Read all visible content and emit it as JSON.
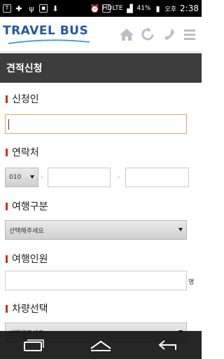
{
  "status_bar": {
    "time": "2:38",
    "ampm": "오후",
    "battery": "41%",
    "network": "LTE",
    "icons": [
      "notification-t-icon",
      "plus-icon",
      "usb-icon",
      "sd-card-icon",
      "download-icon",
      "alarm-icon",
      "hd-icon",
      "lte-icon",
      "signal-icon"
    ]
  },
  "header": {
    "logo_text": "TRAVEL BUS",
    "icons": [
      "home-icon",
      "refresh-icon",
      "phone-icon",
      "menu-icon"
    ]
  },
  "page": {
    "title": "견적신청"
  },
  "form": {
    "applicant": {
      "label": "신청인",
      "value": ""
    },
    "contact": {
      "label": "연락처",
      "prefix": "010",
      "separator": "-",
      "middle": "",
      "last": ""
    },
    "trip_type": {
      "label": "여행구분",
      "selected": "선택해주세요"
    },
    "passengers": {
      "label": "여행인원",
      "value": "",
      "unit": "명"
    },
    "vehicle": {
      "label": "차량선택",
      "selected": "선택해주세요"
    }
  },
  "navbar": {
    "icons": [
      "recent-apps-icon",
      "home-nav-icon",
      "back-icon"
    ]
  },
  "colors": {
    "brand": "#2457a3",
    "title_bar": "#3d3d3d",
    "required_mark": "#d02a2a",
    "focus_border": "#e8a65a"
  }
}
